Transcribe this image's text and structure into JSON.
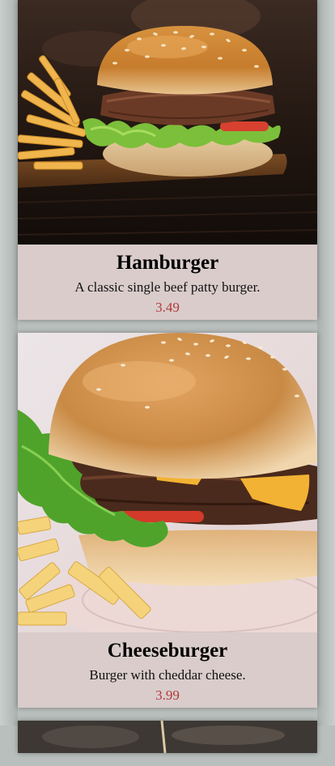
{
  "menu": {
    "items": [
      {
        "name": "Hamburger",
        "description": "A classic single beef patty burger.",
        "price": "3.49",
        "image_icon": "hamburger-photo"
      },
      {
        "name": "Cheeseburger",
        "description": "Burger with cheddar cheese.",
        "price": "3.99",
        "image_icon": "cheeseburger-photo"
      }
    ]
  },
  "colors": {
    "card_background": "#d9cccb",
    "price": "#b23a3a",
    "page_background": "#b9bfbd"
  }
}
